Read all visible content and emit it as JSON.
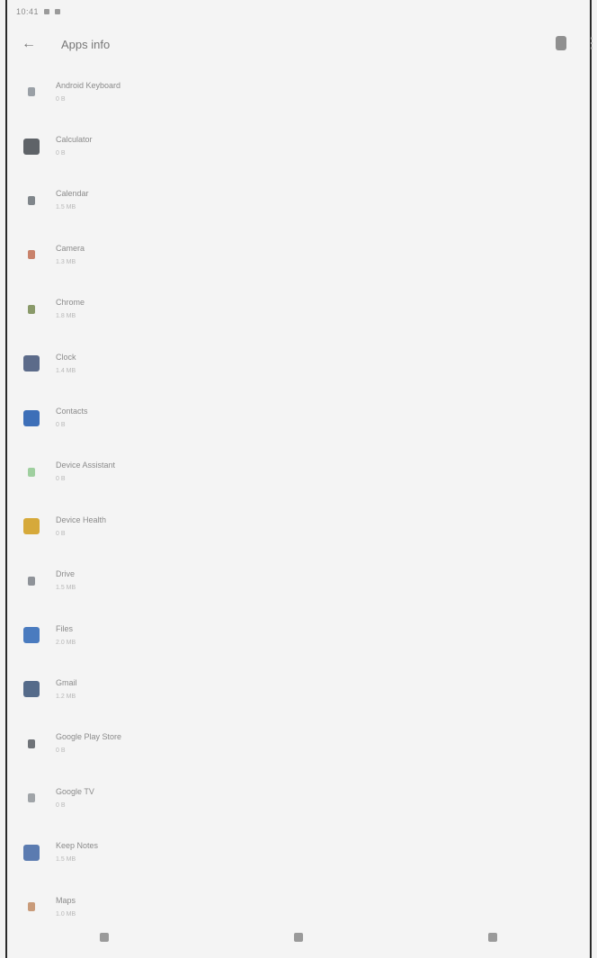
{
  "status_bar": {
    "time": "10:41"
  },
  "app_bar": {
    "title": "Apps info"
  },
  "apps": [
    {
      "name": "Android Keyboard",
      "size": "0 B",
      "icon_color": "#9aa0a6",
      "icon_name": "keyboard-icon",
      "small": true
    },
    {
      "name": "Calculator",
      "size": "0 B",
      "icon_color": "#5f6368",
      "icon_name": "calculator-icon",
      "small": false
    },
    {
      "name": "Calendar",
      "size": "1.5 MB",
      "icon_color": "#80868b",
      "icon_name": "calendar-icon",
      "small": true
    },
    {
      "name": "Camera",
      "size": "1.3 MB",
      "icon_color": "#c9826b",
      "icon_name": "camera-icon",
      "small": true
    },
    {
      "name": "Chrome",
      "size": "1.8 MB",
      "icon_color": "#8a9a6a",
      "icon_name": "chrome-icon",
      "small": true
    },
    {
      "name": "Clock",
      "size": "1.4 MB",
      "icon_color": "#5c6b8a",
      "icon_name": "clock-icon",
      "small": false
    },
    {
      "name": "Contacts",
      "size": "0 B",
      "icon_color": "#3d6fb8",
      "icon_name": "contacts-icon",
      "small": false
    },
    {
      "name": "Device Assistant",
      "size": "0 B",
      "icon_color": "#9fcf9f",
      "icon_name": "assistant-icon",
      "small": true
    },
    {
      "name": "Device Health",
      "size": "0 B",
      "icon_color": "#d6a93a",
      "icon_name": "health-icon",
      "small": false
    },
    {
      "name": "Drive",
      "size": "1.5 MB",
      "icon_color": "#8f9399",
      "icon_name": "drive-icon",
      "small": true
    },
    {
      "name": "Files",
      "size": "2.0 MB",
      "icon_color": "#4a7bbf",
      "icon_name": "files-icon",
      "small": false
    },
    {
      "name": "Gmail",
      "size": "1.2 MB",
      "icon_color": "#556b8a",
      "icon_name": "gmail-icon",
      "small": false
    },
    {
      "name": "Google Play Store",
      "size": "0 B",
      "icon_color": "#6f7378",
      "icon_name": "play-store-icon",
      "small": true
    },
    {
      "name": "Google TV",
      "size": "0 B",
      "icon_color": "#a0a4a8",
      "icon_name": "tv-icon",
      "small": true
    },
    {
      "name": "Keep Notes",
      "size": "1.5 MB",
      "icon_color": "#5b7bb0",
      "icon_name": "keep-icon",
      "small": false
    },
    {
      "name": "Maps",
      "size": "1.0 MB",
      "icon_color": "#c99b7a",
      "icon_name": "maps-icon",
      "small": true
    }
  ]
}
